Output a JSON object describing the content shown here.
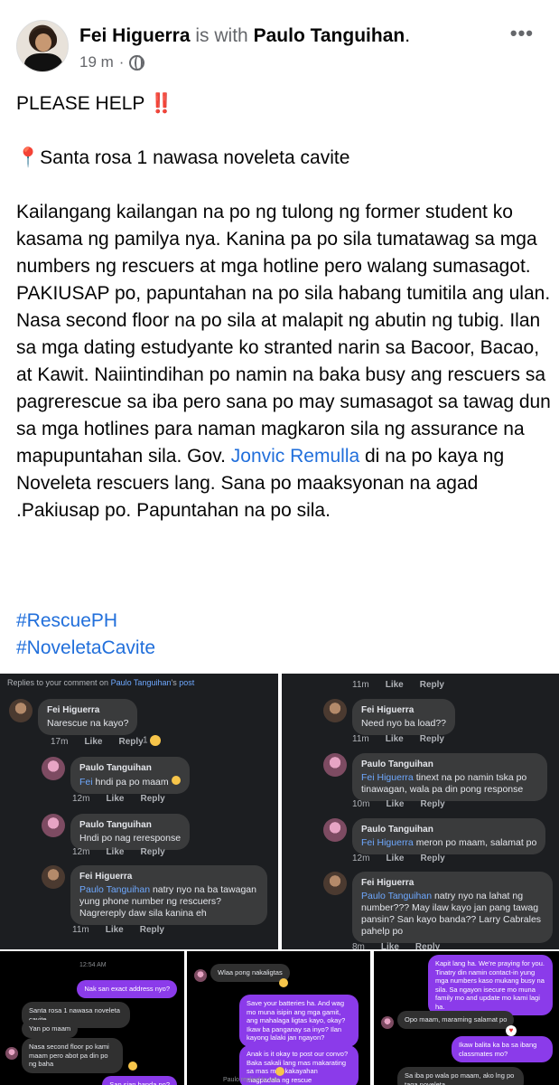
{
  "header": {
    "author": "Fei Higuerra",
    "with_text": "is with",
    "tagged": "Paulo Tanguihan",
    "period": ".",
    "time": "19 m",
    "dot": "·",
    "more": "•••"
  },
  "post": {
    "line1": "PLEASE HELP",
    "line1_emoji": "‼️",
    "location_pin": "📍",
    "location": "Santa rosa 1 nawasa noveleta cavite",
    "body_before": "Kailangang kailangan na po ng tulong ng former student ko kasama ng pamilya nya. Kanina pa po sila tumatawag sa mga numbers ng rescuers at mga hotline pero walang sumasagot. PAKIUSAP po, papuntahan na po sila habang tumitila ang ulan. Nasa second floor na po sila at malapit ng abutin ng tubig. Ilan sa mga dating estudyante ko stranted narin sa Bacoor, Bacao, at Kawit. Naiintindihan po namin na baka busy ang rescuers sa pagrerescue sa iba pero sana po may sumasagot sa tawag dun sa mga hotlines para naman magkaron sila ng assurance na mapupuntahan sila. Gov.",
    "mention": "Jonvic Remulla",
    "body_after": " di na po kaya ng Noveleta rescuers lang. Sana po maaksyonan na agad .Pakiusap po. Papuntahan na po sila.",
    "hashtags": [
      "#RescuePH",
      "#NoveletaCavite"
    ]
  },
  "shot1": {
    "reply_header_a": "Replies to your comment on",
    "reply_header_name": "Paulo Tanguihan",
    "reply_header_b": "'s",
    "reply_header_post": "post",
    "comments": [
      {
        "who": "Fei Higuerra",
        "ref": "",
        "text": "Narescue na kayo?",
        "time": "17m",
        "like": "Like",
        "reply": "Reply",
        "react": "1"
      },
      {
        "who": "Paulo Tanguihan",
        "ref": "Fei",
        "text": " hndi pa po maam",
        "time": "12m",
        "like": "Like",
        "reply": "Reply"
      },
      {
        "who": "Paulo Tanguihan",
        "ref": "",
        "text": "Hndi po nag reresponse",
        "time": "12m",
        "like": "Like",
        "reply": "Reply"
      },
      {
        "who": "Fei Higuerra",
        "ref": "Paulo Tanguihan",
        "text": " natry nyo na ba tawagan yung phone number ng rescuers? Nagrereply daw sila kanina eh",
        "time": "11m",
        "like": "Like",
        "reply": "Reply"
      }
    ]
  },
  "shot2": {
    "top_actions": {
      "time": "11m",
      "like": "Like",
      "reply": "Reply"
    },
    "comments": [
      {
        "who": "Fei Higuerra",
        "ref": "",
        "text": "Need nyo ba load??",
        "time": "11m",
        "like": "Like",
        "reply": "Reply"
      },
      {
        "who": "Paulo Tanguihan",
        "ref": "Fei Higuerra",
        "text": " tinext na po namin tska po tinawagan, wala pa din pong response",
        "time": "10m",
        "like": "Like",
        "reply": "Reply"
      },
      {
        "who": "Paulo Tanguihan",
        "ref": "Fei Higuerra",
        "text": " meron po maam, salamat po",
        "time": "12m",
        "like": "Like",
        "reply": "Reply"
      },
      {
        "who": "Fei Higuerra",
        "ref": "Paulo Tanguihan",
        "text": " natry nyo na lahat ng number??? May ilaw kayo jan pang tawag pansin? San kayo banda?? Larry Cabrales pahelp po",
        "time": "8m",
        "like": "Like",
        "reply": "Reply"
      }
    ]
  },
  "shot3": {
    "time": "12:54 AM",
    "messages": [
      {
        "dir": "out",
        "text": "Nak san exact address nyo?"
      },
      {
        "dir": "in",
        "text": "Santa rosa 1 nawasa noveleta cavite"
      },
      {
        "dir": "in",
        "text": "Yan po maam"
      },
      {
        "dir": "in",
        "text": "Nasa second floor po kami maam pero abot pa din po ng baha"
      },
      {
        "dir": "out",
        "text": "San sian banda po?"
      }
    ]
  },
  "shot4": {
    "messages": [
      {
        "dir": "in",
        "text": "Wlaa pong nakaligtas"
      },
      {
        "dir": "out",
        "text": "Save your batteries ha. And wag mo muna isipin ang mga gamit, ang mahalaga ligtas kayo, okay? Ikaw ba panganay sa inyo? Ilan kayong lalaki jan ngayon?"
      },
      {
        "dir": "out",
        "text": "Anak is it okay to post our convo? Baka sakali lang mas makarating sa mas may kakayahan magpadala ng rescue"
      }
    ],
    "footer": "Paulo replied to you"
  },
  "shot5": {
    "messages": [
      {
        "dir": "out",
        "text": "Kapit lang ha. We're praying for you. Tinatry din namin contact-in yung mga numbers kaso mukang busy na sila. Sa ngayon isecure mo muna family mo and update mo kami lagi ha."
      },
      {
        "dir": "in",
        "text": "Opo maam, maraming salamat po"
      },
      {
        "dir": "out",
        "text": "Ikaw balita ka ba sa ibang classmates mo?"
      },
      {
        "dir": "in",
        "text": "Sa iba po wala po maam, ako lng po taga noveleta"
      }
    ]
  },
  "colors": {
    "link": "#216fdb",
    "meta": "#65676b",
    "dark_bg": "#1c1e21",
    "bubble": "#3a3b3c",
    "purple": "#8b3bea"
  }
}
